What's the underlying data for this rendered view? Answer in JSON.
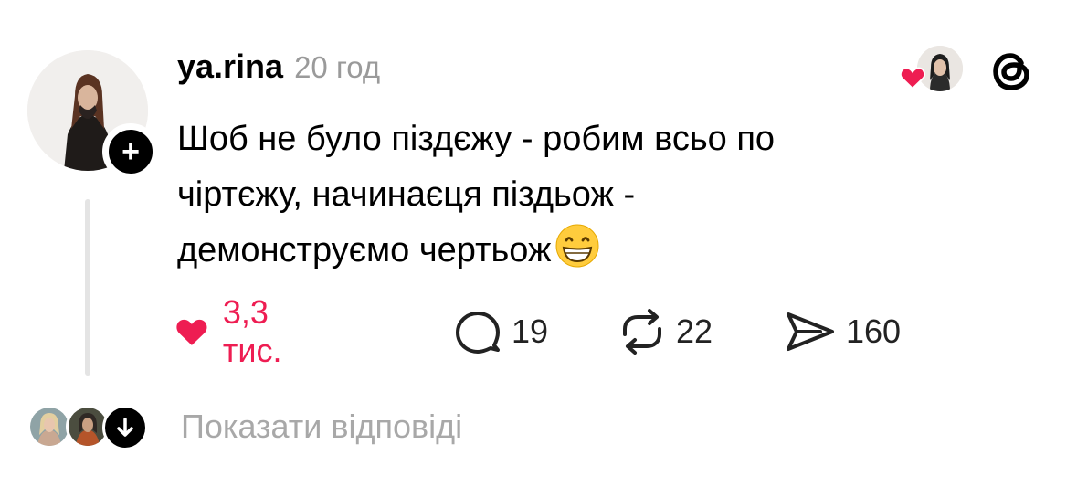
{
  "post": {
    "username": "ya.rina",
    "time": "20 год",
    "text_line1": "Шоб не було піздєжу - робим всьо по",
    "text_line2": "чіртєжу, начинаєця піздьож -",
    "text_line3": "демонструємо чертьож"
  },
  "actions": {
    "likes": "3,3 тис.",
    "comments": "19",
    "reposts": "22",
    "shares": "160"
  },
  "replies": {
    "show_label": "Показати відповіді"
  },
  "icons": {
    "follow": "plus-icon",
    "like": "heart-icon",
    "comment": "comment-bubble-icon",
    "repost": "repost-icon",
    "share": "paper-plane-icon",
    "app": "threads-logo-icon",
    "emoji": "grinning-face-emoji",
    "expand": "arrow-down-icon"
  },
  "colors": {
    "like_red": "#ee1d52",
    "muted_gray": "#9a9a9a",
    "text": "#000000"
  }
}
